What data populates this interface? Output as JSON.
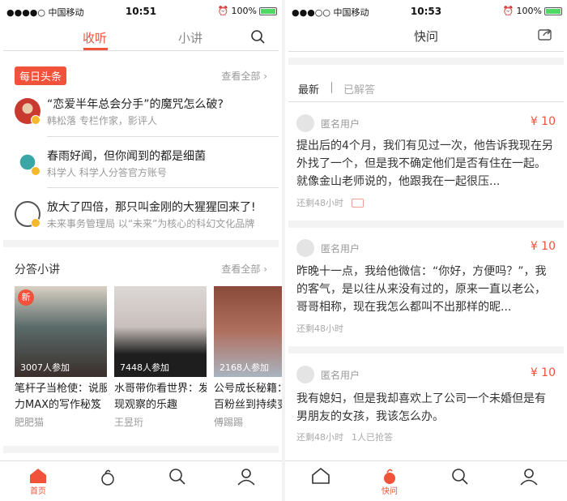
{
  "colors": {
    "accent": "#f0523a",
    "verified": "#f5b72b",
    "battery": "#4cd964"
  },
  "left": {
    "status": {
      "carrier": "●●●●○ 中国移动",
      "time": "10:51",
      "battery": "100%"
    },
    "tabs": [
      {
        "label": "收听",
        "active": true
      },
      {
        "label": "小讲",
        "active": false
      }
    ],
    "daily": {
      "badge": "每日头条",
      "see_all": "查看全部 ›",
      "items": [
        {
          "title": "“恋爱半年总会分手”的魔咒怎么破?",
          "sub": "韩松落 专栏作家，影评人"
        },
        {
          "title": "春雨好闻，但你闻到的都是细菌",
          "sub": "科学人 科学人分答官方账号"
        },
        {
          "title": "放大了四倍，那只叫金刚的大猩猩回来了!",
          "sub": "未来事务管理局 以“未来”为核心的科幻文化品牌"
        }
      ]
    },
    "talks": {
      "title": "分答小讲",
      "see_all": "查看全部 ›",
      "new_badge": "新",
      "cards": [
        {
          "count": "3007人参加",
          "title1": "笔杆子当枪使：说服",
          "title2": "力MAX的写作秘笈",
          "author": "肥肥猫"
        },
        {
          "count": "7448人参加",
          "title1": "水哥带你看世界：发",
          "title2": "现观察的乐趣",
          "author": "王昱珩"
        },
        {
          "count": "2168人参加",
          "title1": "公号成长秘籍：",
          "title2": "百粉丝到持续变",
          "author": "傅踢踢"
        }
      ]
    },
    "tabbar": {
      "home": "首页"
    }
  },
  "right": {
    "status": {
      "carrier": "●●●○○ 中国移动",
      "time": "10:53",
      "battery": "100%"
    },
    "title": "快问",
    "filters": [
      {
        "label": "最新",
        "active": true
      },
      {
        "label": "已解答",
        "active": false
      }
    ],
    "questions": [
      {
        "user": "匿名用户",
        "price": "¥ 10",
        "text": "提出后的4个月，我们有见过一次，他告诉我现在另外找了一个，但是我不确定他们是否有住在一起。就像金山老师说的，他跟我在一起很压...",
        "time": "还剩48小时",
        "extra": "",
        "has_image": true
      },
      {
        "user": "匿名用户",
        "price": "¥ 10",
        "text": "昨晚十一点，我给他微信：“你好，方便吗？”，我的客气，是以往从来没有过的，原来一直以老公，哥哥相称，现在我怎么都叫不出那样的昵...",
        "time": "还剩48小时",
        "extra": "",
        "has_image": false
      },
      {
        "user": "匿名用户",
        "price": "¥ 10",
        "text": "我有媳妇，但是我却喜欢上了公司一个未婚但是有男朋友的女孩，我该怎么办。",
        "time": "还剩48小时",
        "extra": "1人已抢答",
        "has_image": false
      }
    ],
    "tabbar": {
      "ask": "快问"
    }
  }
}
